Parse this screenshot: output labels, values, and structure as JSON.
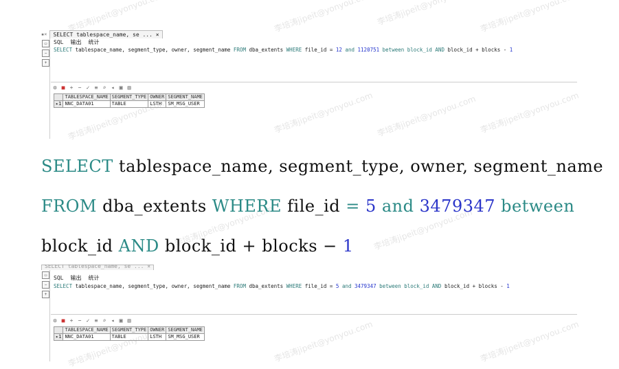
{
  "top_panel": {
    "tab_label": "SELECT tablespace_name, se ... ×",
    "subtabs": [
      "SQL",
      "输出",
      "统计"
    ],
    "sql_parts": {
      "p1": "SELECT",
      "p2": " tablespace_name, segment_type, owner, segment_name ",
      "p3": "FROM",
      "p4": " dba_extents ",
      "p5": "WHERE",
      "p6": " file_id = ",
      "p7": "12",
      "p8": " and ",
      "p9": "1120751",
      "p10": " between block_id ",
      "p11": "AND",
      "p12": " block_id + blocks - ",
      "p13": "1"
    },
    "grid": {
      "headers": [
        "TABLESPACE_NAME",
        "SEGMENT_TYPE",
        "OWNER",
        "SEGMENT_NAME"
      ],
      "row_num": "1",
      "row": [
        "NNC_DATA01",
        "TABLE",
        "LSTH",
        "SM_MSG_USER"
      ]
    }
  },
  "big_sql": {
    "l1a": "SELECT",
    "l1b": " tablespace_name,  segment_type,  owner,  segment_name",
    "l2a": "FROM",
    "l2b": " dba_extents ",
    "l2c": "WHERE",
    "l2d": " file_id ",
    "l2e": "=",
    "l2f": " 5 ",
    "l2g": "and",
    "l2h": " 3479347 ",
    "l2i": "between",
    "l3a": "block_id ",
    "l3b": "AND",
    "l3c": " block_id + blocks − ",
    "l3d": "1"
  },
  "bottom_panel": {
    "tab_label": "SELECT tablespace_name, se ... ×",
    "subtabs": [
      "SQL",
      "输出",
      "统计"
    ],
    "sql_parts": {
      "p1": "SELECT",
      "p2": " tablespace_name, segment_type, owner, segment_name ",
      "p3": "FROM",
      "p4": " dba_extents ",
      "p5": "WHERE",
      "p6": " file_id = ",
      "p7": "5",
      "p8": " and ",
      "p9": "3479347",
      "p10": " between block_id ",
      "p11": "AND",
      "p12": " block_id + blocks - ",
      "p13": "1"
    },
    "grid": {
      "headers": [
        "TABLESPACE_NAME",
        "SEGMENT_TYPE",
        "OWNER",
        "SEGMENT_NAME"
      ],
      "row_num": "1",
      "row": [
        "NNC_DATA01",
        "TABLE",
        "LSTH",
        "SM_MSG_USER"
      ]
    }
  },
  "watermark": "李培涛jipeit@yonyou.com",
  "colors": {
    "keyword": "#2b8a86",
    "number": "#2b35c9"
  }
}
